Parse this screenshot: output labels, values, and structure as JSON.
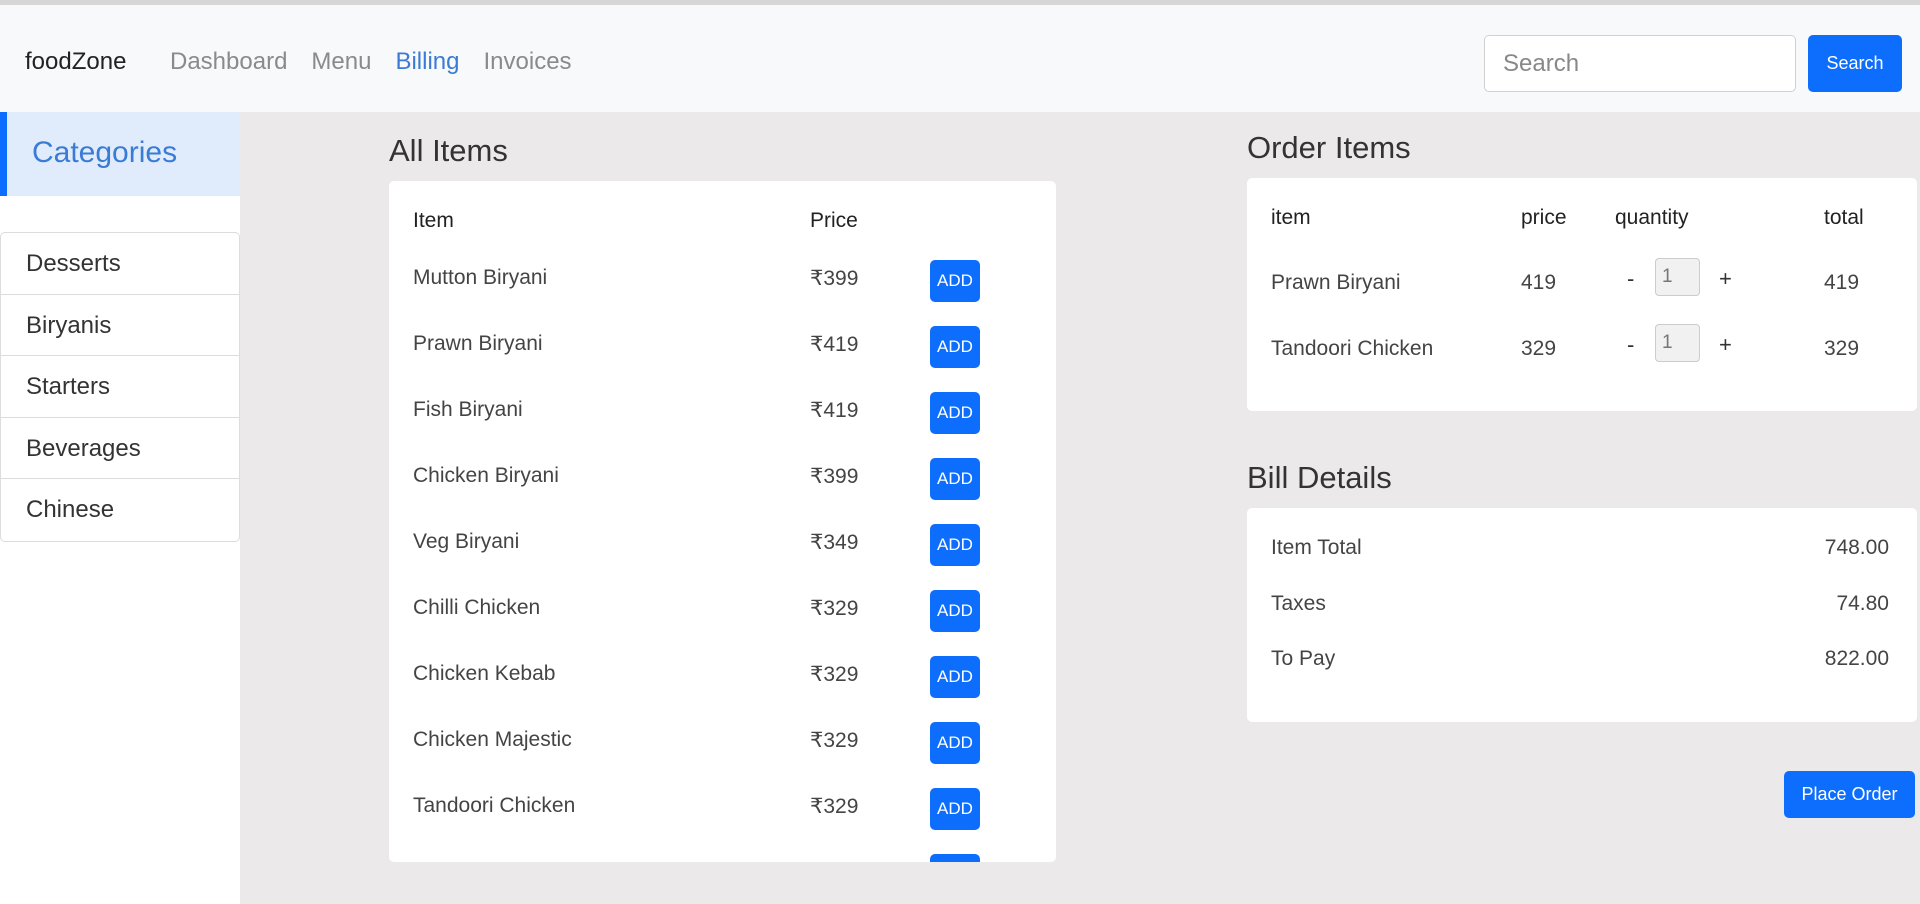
{
  "navbar": {
    "brand": "foodZone",
    "links": [
      "Dashboard",
      "Menu",
      "Billing",
      "Invoices"
    ],
    "active": "Billing",
    "search_placeholder": "Search",
    "search_button": "Search"
  },
  "sidebar": {
    "header": "Categories",
    "categories": [
      "Desserts",
      "Biryanis",
      "Starters",
      "Beverages",
      "Chinese"
    ]
  },
  "all_items": {
    "title": "All Items",
    "col_item": "Item",
    "col_price": "Price",
    "add_label": "ADD",
    "rows": [
      {
        "name": "Mutton Biryani",
        "price": "₹399"
      },
      {
        "name": "Prawn Biryani",
        "price": "₹419"
      },
      {
        "name": "Fish Biryani",
        "price": "₹419"
      },
      {
        "name": "Chicken Biryani",
        "price": "₹399"
      },
      {
        "name": "Veg Biryani",
        "price": "₹349"
      },
      {
        "name": "Chilli Chicken",
        "price": "₹329"
      },
      {
        "name": "Chicken Kebab",
        "price": "₹329"
      },
      {
        "name": "Chicken Majestic",
        "price": "₹329"
      },
      {
        "name": "Tandoori Chicken",
        "price": "₹329"
      }
    ]
  },
  "order_items": {
    "title": "Order Items",
    "col_item": "item",
    "col_price": "price",
    "col_quantity": "quantity",
    "col_total": "total",
    "minus": "-",
    "plus": "+",
    "rows": [
      {
        "name": "Prawn Biryani",
        "price": "419",
        "qty": "1",
        "total": "419"
      },
      {
        "name": "Tandoori Chicken",
        "price": "329",
        "qty": "1",
        "total": "329"
      }
    ]
  },
  "bill": {
    "title": "Bill Details",
    "item_total_label": "Item Total",
    "item_total": "748.00",
    "taxes_label": "Taxes",
    "taxes": "74.80",
    "to_pay_label": "To Pay",
    "to_pay": "822.00"
  },
  "place_order": "Place Order",
  "colors": {
    "primary": "#0d6efd",
    "active_link": "#3a7bd5",
    "background": "#ebe9e9"
  }
}
